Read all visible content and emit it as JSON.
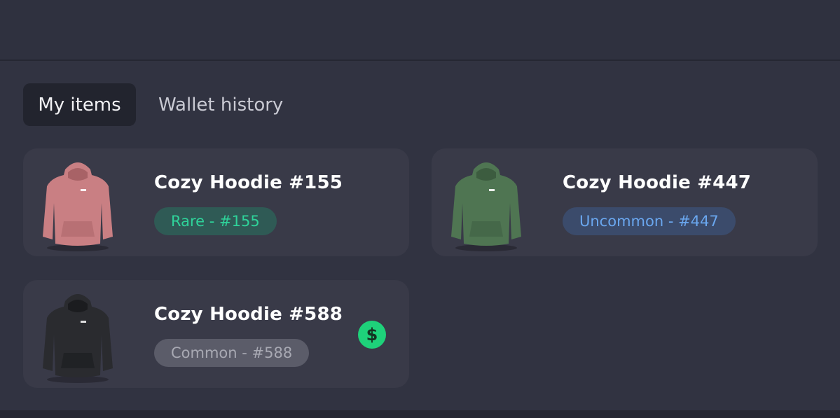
{
  "tabs": [
    {
      "label": "My items",
      "active": true
    },
    {
      "label": "Wallet history",
      "active": false
    }
  ],
  "items": [
    {
      "title": "Cozy Hoodie #155",
      "badge": "Rare - #155",
      "rarity": "rare",
      "hoodie_color": "#c97f83",
      "hoodie_shade": "#a86266"
    },
    {
      "title": "Cozy Hoodie #447",
      "badge": "Uncommon - #447",
      "rarity": "uncommon",
      "hoodie_color": "#4f7552",
      "hoodie_shade": "#3c5c3f"
    },
    {
      "title": "Cozy Hoodie #588",
      "badge": "Common - #588",
      "rarity": "common",
      "hoodie_color": "#2a2b2f",
      "hoodie_shade": "#1b1c1f",
      "sale_icon": "dollar-icon",
      "sale_symbol": "$"
    }
  ],
  "colors": {
    "background": "#313341",
    "card": "#393a48",
    "rare_text": "#2fd39a",
    "uncommon_text": "#6aa7ef",
    "common_text": "#a8a9b3",
    "dollar_badge": "#1ed17a"
  }
}
